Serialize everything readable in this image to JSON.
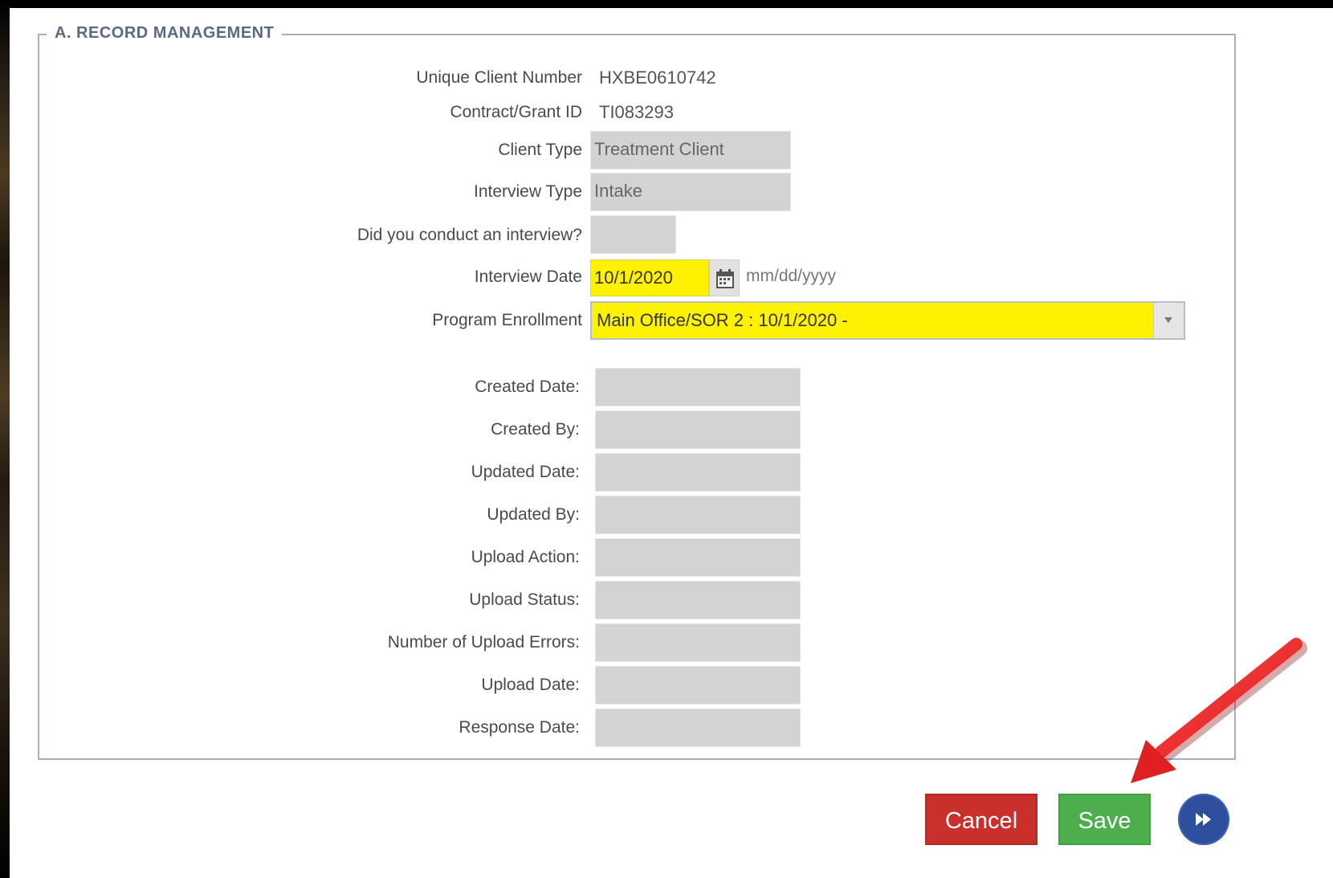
{
  "section": {
    "legend": "A. RECORD MANAGEMENT"
  },
  "fields": {
    "unique_client_number": {
      "label": "Unique Client Number",
      "value": "HXBE0610742"
    },
    "contract_grant_id": {
      "label": "Contract/Grant ID",
      "value": "TI083293"
    },
    "client_type": {
      "label": "Client Type",
      "value": "Treatment Client"
    },
    "interview_type": {
      "label": "Interview Type",
      "value": "Intake"
    },
    "conducted_interview": {
      "label": "Did you conduct an interview?",
      "value": ""
    },
    "interview_date": {
      "label": "Interview Date",
      "value": "10/1/2020",
      "hint": "mm/dd/yyyy"
    },
    "program_enrollment": {
      "label": "Program Enrollment",
      "value": "Main Office/SOR 2 : 10/1/2020 -"
    }
  },
  "audit": {
    "created_date": {
      "label": "Created Date:",
      "value": ""
    },
    "created_by": {
      "label": "Created By:",
      "value": ""
    },
    "updated_date": {
      "label": "Updated Date:",
      "value": ""
    },
    "updated_by": {
      "label": "Updated By:",
      "value": ""
    },
    "upload_action": {
      "label": "Upload Action:",
      "value": ""
    },
    "upload_status": {
      "label": "Upload Status:",
      "value": ""
    },
    "upload_errors": {
      "label": "Number of Upload Errors:",
      "value": ""
    },
    "upload_date": {
      "label": "Upload Date:",
      "value": ""
    },
    "response_date": {
      "label": "Response Date:",
      "value": ""
    }
  },
  "actions": {
    "cancel_label": "Cancel",
    "save_label": "Save"
  },
  "colors": {
    "highlight": "#fff200",
    "cancel": "#c9302c",
    "save": "#4cae4c",
    "next": "#2d4f9e",
    "annotation_arrow": "#e02020"
  },
  "icons": {
    "calendar": "calendar-icon",
    "select_caret": "chevron-down-icon",
    "next": "fast-forward-icon",
    "annotation": "red-arrow-annotation"
  }
}
